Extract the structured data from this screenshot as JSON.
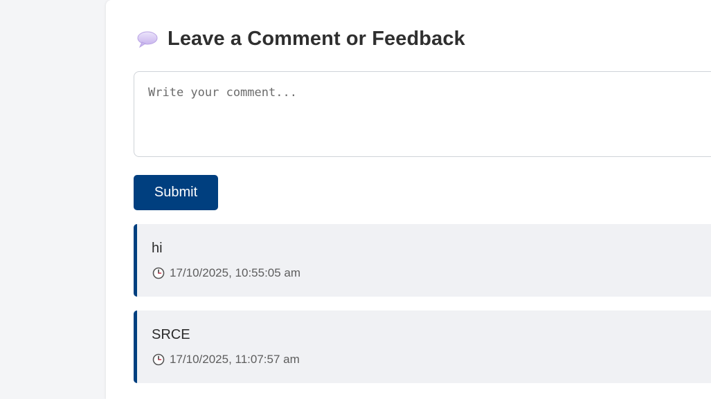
{
  "form": {
    "title": "Leave a Comment or Feedback",
    "title_icon": "speech-bubble-icon",
    "comment_placeholder": "Write your comment...",
    "comment_value": "",
    "submit_label": "Submit"
  },
  "colors": {
    "accent": "#003f7f",
    "comment_bg": "#f0f1f4",
    "page_bg": "#f4f5f7"
  },
  "comments": [
    {
      "text": "hi",
      "timestamp": "17/10/2025, 10:55:05 am",
      "icon": "clock-icon"
    },
    {
      "text": "SRCE",
      "timestamp": "17/10/2025, 11:07:57 am",
      "icon": "clock-icon"
    }
  ]
}
